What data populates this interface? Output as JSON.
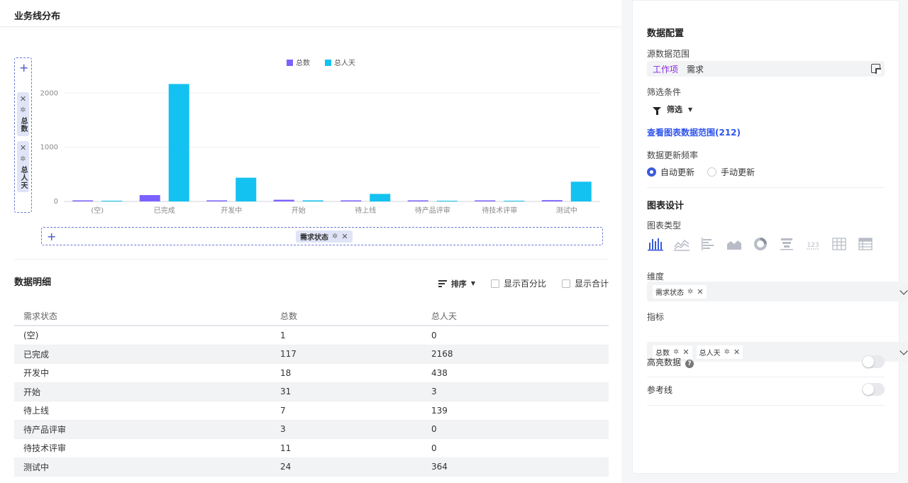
{
  "header": {
    "title": "业务线分布"
  },
  "y_fields": [
    {
      "label": "总数"
    },
    {
      "label": "总人天"
    }
  ],
  "x_field": {
    "label": "需求状态"
  },
  "chart_data": {
    "type": "bar",
    "categories": [
      "(空)",
      "已完成",
      "开发中",
      "开始",
      "待上线",
      "待产品评审",
      "待技术评审",
      "测试中"
    ],
    "series": [
      {
        "name": "总数",
        "values": [
          1,
          117,
          18,
          31,
          7,
          3,
          11,
          24
        ],
        "color": "#7b61ff"
      },
      {
        "name": "总人天",
        "values": [
          0,
          2168,
          438,
          3,
          139,
          0,
          0,
          364
        ],
        "color": "#13c2f0"
      }
    ],
    "yticks": [
      0,
      1000,
      2000
    ],
    "ylim": [
      0,
      2200
    ],
    "grid": true,
    "legend": "top-center"
  },
  "detail": {
    "title": "数据明细",
    "sort_label": "排序",
    "show_percent": "显示百分比",
    "show_total": "显示合计",
    "columns": [
      "需求状态",
      "总数",
      "总人天"
    ],
    "rows": [
      [
        "(空)",
        "1",
        "0"
      ],
      [
        "已完成",
        "117",
        "2168"
      ],
      [
        "开发中",
        "18",
        "438"
      ],
      [
        "开始",
        "31",
        "3"
      ],
      [
        "待上线",
        "7",
        "139"
      ],
      [
        "待产品评审",
        "3",
        "0"
      ],
      [
        "待技术评审",
        "11",
        "0"
      ],
      [
        "测试中",
        "24",
        "364"
      ]
    ]
  },
  "config": {
    "title": "数据配置",
    "source_label": "源数据范围",
    "source_tag": "工作项",
    "source_value": "需求",
    "filter_label": "筛选条件",
    "filter_button": "筛选",
    "view_range_link": "查看图表数据范围(212)",
    "refresh_label": "数据更新频率",
    "refresh_auto": "自动更新",
    "refresh_manual": "手动更新"
  },
  "design": {
    "title": "图表设计",
    "chart_type_label": "图表类型",
    "dimension_label": "维度",
    "dimension_chip": "需求状态",
    "metric_label": "指标",
    "metric_chips": [
      "总数",
      "总人天"
    ],
    "highlight_label": "高亮数据",
    "reference_label": "参考线",
    "type_icons": [
      "bar-chart-icon",
      "line-chart-icon",
      "horizontal-bar-icon",
      "area-chart-icon",
      "donut-chart-icon",
      "funnel-chart-icon",
      "number-card-icon",
      "table-icon",
      "pivot-table-icon"
    ]
  },
  "colors": {
    "accent": "#3b5bdb",
    "series1": "#7b61ff",
    "series2": "#13c2f0"
  }
}
